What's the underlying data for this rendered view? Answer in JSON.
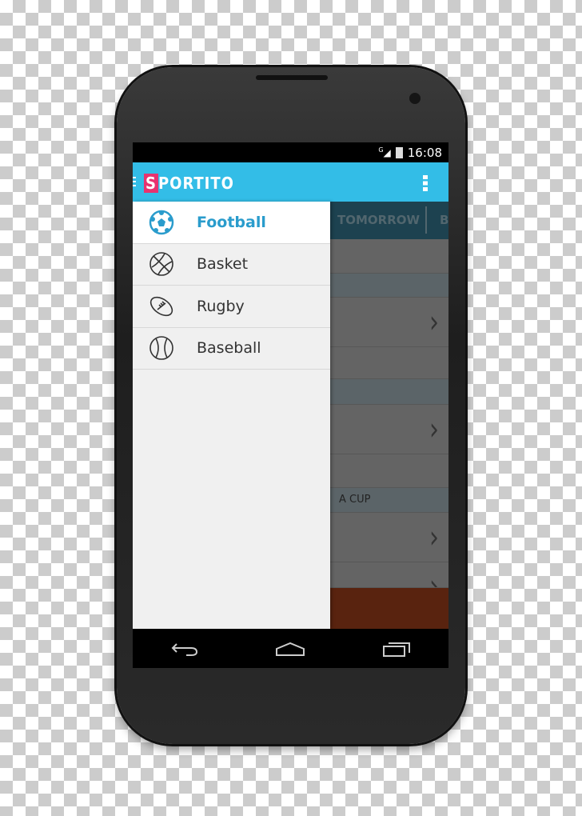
{
  "status": {
    "time": "16:08",
    "network": "G",
    "icons": [
      "signal-icon",
      "battery-charging-icon"
    ]
  },
  "actionbar": {
    "logo_text": "SPORTITO",
    "menu_icon": "overflow-menu-icon"
  },
  "tabs": {
    "visible": [
      "TOMORROW",
      "B"
    ]
  },
  "content": {
    "header_partial": "A CUP"
  },
  "drawer": {
    "items": [
      {
        "label": "Football",
        "icon": "football-icon",
        "active": true
      },
      {
        "label": "Basket",
        "icon": "basketball-icon",
        "active": false
      },
      {
        "label": "Rugby",
        "icon": "rugby-ball-icon",
        "active": false
      },
      {
        "label": "Baseball",
        "icon": "baseball-icon",
        "active": false
      }
    ]
  },
  "navbar": {
    "buttons": [
      "back",
      "home",
      "recent-apps"
    ]
  },
  "colors": {
    "accent": "#33bde7",
    "active_text": "#2a9ccc",
    "logo": "#e8336f"
  }
}
